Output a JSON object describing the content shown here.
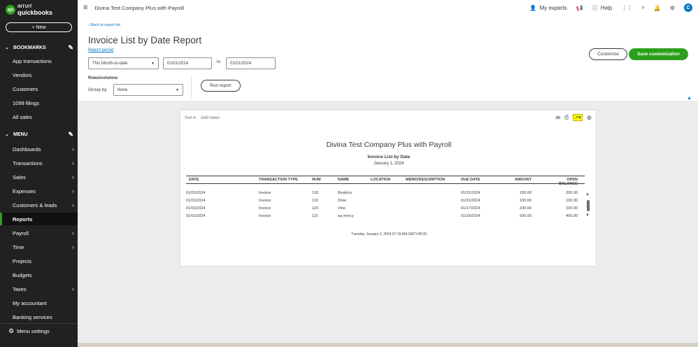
{
  "brand": {
    "logo_mark": "qb",
    "line1": "INTUIT",
    "line2": "quickbooks",
    "accent": "#2ca01c"
  },
  "sidebar": {
    "new_label": "+ New",
    "bookmarks_label": "BOOKMARKS",
    "bookmarks": [
      "App transactions",
      "Vendors",
      "Customers",
      "1099 filings",
      "All sales"
    ],
    "menu_label": "MENU",
    "menu": [
      {
        "label": "Dashboards",
        "arrow": true
      },
      {
        "label": "Transactions",
        "arrow": true
      },
      {
        "label": "Sales",
        "arrow": true
      },
      {
        "label": "Expenses",
        "arrow": true
      },
      {
        "label": "Customers & leads",
        "arrow": true
      },
      {
        "label": "Reports",
        "arrow": false,
        "active": true
      },
      {
        "label": "Payroll",
        "arrow": true
      },
      {
        "label": "Time",
        "arrow": true
      },
      {
        "label": "Projects",
        "arrow": false
      },
      {
        "label": "Budgets",
        "arrow": false
      },
      {
        "label": "Taxes",
        "arrow": true
      },
      {
        "label": "My accountant",
        "arrow": false
      },
      {
        "label": "Banking services",
        "arrow": false
      }
    ],
    "menu_settings": "Menu settings"
  },
  "topbar": {
    "company": "Divina Test Company Plus with Payroll",
    "my_experts": "My experts",
    "help": "Help",
    "avatar": "C"
  },
  "header": {
    "back_link": "Back to report list",
    "title": "Invoice List by Date Report",
    "period_label": "Report period",
    "period_value": "This Month-to-date",
    "from_date": "01/01/2024",
    "to_label": "to",
    "to_date": "01/01/2024",
    "rows_columns": "Rows/columns",
    "group_by_label": "Group by",
    "group_by_value": "None",
    "run_report": "Run report",
    "customize": "Customize",
    "save_customization": "Save customization"
  },
  "report": {
    "sort": "Sort ▾",
    "add_notes": "Add notes",
    "company": "Divina Test Company Plus with Payroll",
    "title": "Invoice List by Date",
    "date": "January 1, 2024",
    "columns": [
      "DATE",
      "TRANSACTION TYPE",
      "NUM",
      "NAME",
      "LOCATION",
      "MEMO/DESCRIPTION",
      "DUE DATE",
      "AMOUNT",
      "OPEN BALANCE"
    ],
    "rows": [
      [
        "01/01/2024",
        "Invoice",
        "118",
        "Beatrice",
        "",
        "",
        "01/31/2024",
        "200.00",
        "200.00"
      ],
      [
        "01/01/2024",
        "Invoice",
        "119",
        "Divie",
        "",
        "",
        "01/31/2024",
        "100.00",
        "100.00"
      ],
      [
        "01/01/2024",
        "Invoice",
        "120",
        "Vine",
        "",
        "",
        "01/17/2024",
        "200.00",
        "100.00"
      ],
      [
        "01/01/2024",
        "Invoice",
        "121",
        "aa mercy",
        "",
        "",
        "01/16/2024",
        "500.00",
        "400.00"
      ]
    ],
    "footer": "Tuesday, January 2, 2024   07:15 AM GMT+08:00"
  }
}
